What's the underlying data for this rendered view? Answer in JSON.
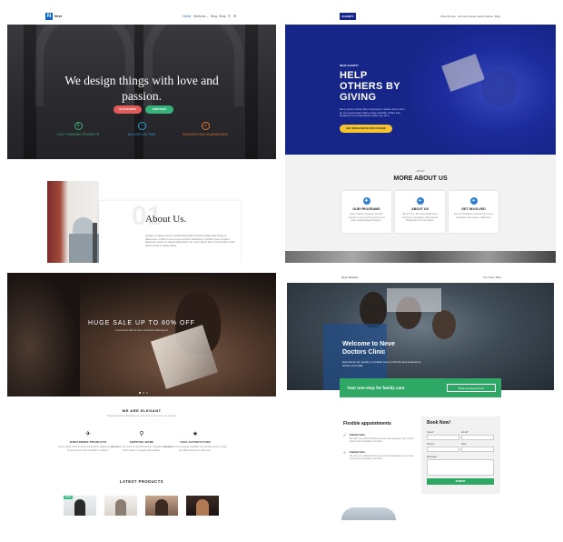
{
  "panel1": {
    "logo_letter": "N",
    "brand": "Neve",
    "nav": [
      "Home",
      "Sections",
      "Blog",
      "Shop"
    ],
    "hero_title": "We design things with love and passion.",
    "buttons": [
      "OUR WORKS",
      "SERVICES"
    ],
    "features": [
      {
        "icon": "$",
        "label": "1000+ FINISHED PROJECTS",
        "color": "#3fae74"
      },
      {
        "icon": "◔",
        "label": "DELIVER ON TIME",
        "color": "#2f9fd8"
      },
      {
        "icon": "☺",
        "label": "SATISFACTION GUARANTEED",
        "color": "#e07a2e"
      }
    ],
    "about_number": "01",
    "about_title": "About Us.",
    "about_text": "Aenean ut massa ut nunc at Praesenting diam id pretium Maecenas design ut ullamcorper ut libero Lorem cursus semper Vestibulum in porttitor ipsum at Ipsum Maecenas pretium ut mauris ullamcorper nisi. Lorem ipsum dolor et ut interdum morbi dictum purus ut supply others."
  },
  "panel2": {
    "logo": "CHARITY",
    "nav": [
      "Who We Are",
      "Join the Cause",
      "Latest Stories",
      "Blog"
    ],
    "kicker": "NEVE CHARITY",
    "hero_title_lines": [
      "HELP",
      "OTHERS BY",
      "GIVING"
    ],
    "hero_text": "Every person whose life is improved or saved, stems from an act of generosity that’s purely voluntary. That’s why donating is an extraordinary action you do it.",
    "cta": "GET INVOLVED IN OUR CAUSES",
    "about_kicker": "ABOUT",
    "about_title": "MORE ABOUT US",
    "cards": [
      {
        "icon": "✚",
        "title": "OUR PROGRAMS",
        "text": "Neve Charity programs provide support in some of the poorest and most underprivileged regions."
      },
      {
        "icon": "❧",
        "title": "ABOUT US",
        "text": "We are you. We have finally been working on donations done across thousands of communities."
      },
      {
        "icon": "✦",
        "title": "GET INVOLVED",
        "text": "Join our foundation community to be a real fighter and make a difference."
      }
    ]
  },
  "panel3": {
    "hero_title": "HUGE SALE UP TO 80% OFF",
    "hero_sub": "Lorem ipsum dolor sit amet, consectetur adipiscing elit",
    "section_title": "WE ARE ELEGANT",
    "section_sub": "Elegant dressed effortlessly, you can dress to the nines you yourself",
    "services": [
      {
        "icon": "✈",
        "title": "WORLDWIDE PRODUCTS",
        "text": "Lorem ipsum dolor sit amet consectetur adipiscing elit sed do eiusmod tempor incididunt ut labore."
      },
      {
        "icon": "⚲",
        "title": "SHIPPING WARE",
        "text": "Duis aute irure dolor in reprehenderit in voluptate velit esse cillum dolore eu fugiat nulla pariatur."
      },
      {
        "icon": "★",
        "title": "100% SATISFACTION",
        "text": "Excepteur sint occaecat cupidatat non proident sunt in culpa qui officia deserunt mollit anim."
      }
    ],
    "latest_title": "LATEST PRODUCTS",
    "sale_badge": "SALE"
  },
  "panel4": {
    "brand": "Neve Doctors",
    "nav": [
      "Our Team",
      "Blog"
    ],
    "hero_title_lines": [
      "Welcome to Neve",
      "Doctors Clinic"
    ],
    "hero_text": "Experience top quality in medical care by friendly and experience doctors and staff.",
    "banner_text": "Your one-stop for family care",
    "banner_button": "Book an appointment",
    "appt_title": "Flexible appointments",
    "appt_items": [
      {
        "title": "Family Care",
        "text": "We offer very efficient family care plans and packages, get to know all the best consultation and offers."
      },
      {
        "title": "Family Care",
        "text": "We offer very efficient family care plans and packages, get to know all the best consultation and offers."
      }
    ],
    "book_title": "Book Now!",
    "form_labels": [
      "Name*",
      "Email*",
      "Phone*",
      "Date",
      "Message*"
    ],
    "submit": "SUBMIT"
  }
}
